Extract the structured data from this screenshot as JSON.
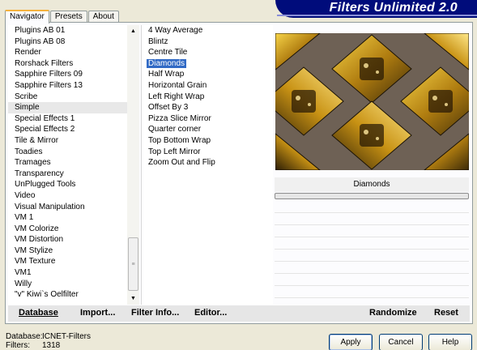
{
  "tabs": [
    {
      "label": "Navigator",
      "active": true
    },
    {
      "label": "Presets",
      "active": false
    },
    {
      "label": "About",
      "active": false
    }
  ],
  "banner": {
    "title": "Filters Unlimited 2.0"
  },
  "categories": [
    "Plugins AB 01",
    "Plugins AB 08",
    "Render",
    "Rorshack Filters",
    "Sapphire Filters 09",
    "Sapphire Filters 13",
    "Scribe",
    "Simple",
    "Special Effects 1",
    "Special Effects 2",
    "Tile & Mirror",
    "Toadies",
    "Tramages",
    "Transparency",
    "UnPlugged Tools",
    "Video",
    "Visual Manipulation",
    "VM 1",
    "VM Colorize",
    "VM Distortion",
    "VM Stylize",
    "VM Texture",
    "VM1",
    "Willy",
    "\"v\" Kiwi`s Oelfilter"
  ],
  "selected_category": "Simple",
  "filters": [
    "4 Way Average",
    "Blintz",
    "Centre Tile",
    "Diamonds",
    "Half Wrap",
    "Horizontal Grain",
    "Left Right Wrap",
    "Offset By 3",
    "Pizza Slice Mirror",
    "Quarter corner",
    "Top Bottom Wrap",
    "Top Left Mirror",
    "Zoom Out and Flip"
  ],
  "selected_filter": "Diamonds",
  "effect_name": "Diamonds",
  "bottom_bar": {
    "database": "Database",
    "import": "Import...",
    "filter_info": "Filter Info...",
    "editor": "Editor...",
    "randomize": "Randomize",
    "reset": "Reset"
  },
  "status": {
    "database_label": "Database:",
    "database_value": "ICNET-Filters",
    "filters_label": "Filters:",
    "filters_value": "1318"
  },
  "buttons": {
    "apply": "Apply",
    "cancel": "Cancel",
    "help": "Help"
  },
  "colors": {
    "banner": "#000c7b",
    "selection": "#316ac5",
    "preview_bg": "#6e6155",
    "preview_gold": "#d4a11a"
  }
}
